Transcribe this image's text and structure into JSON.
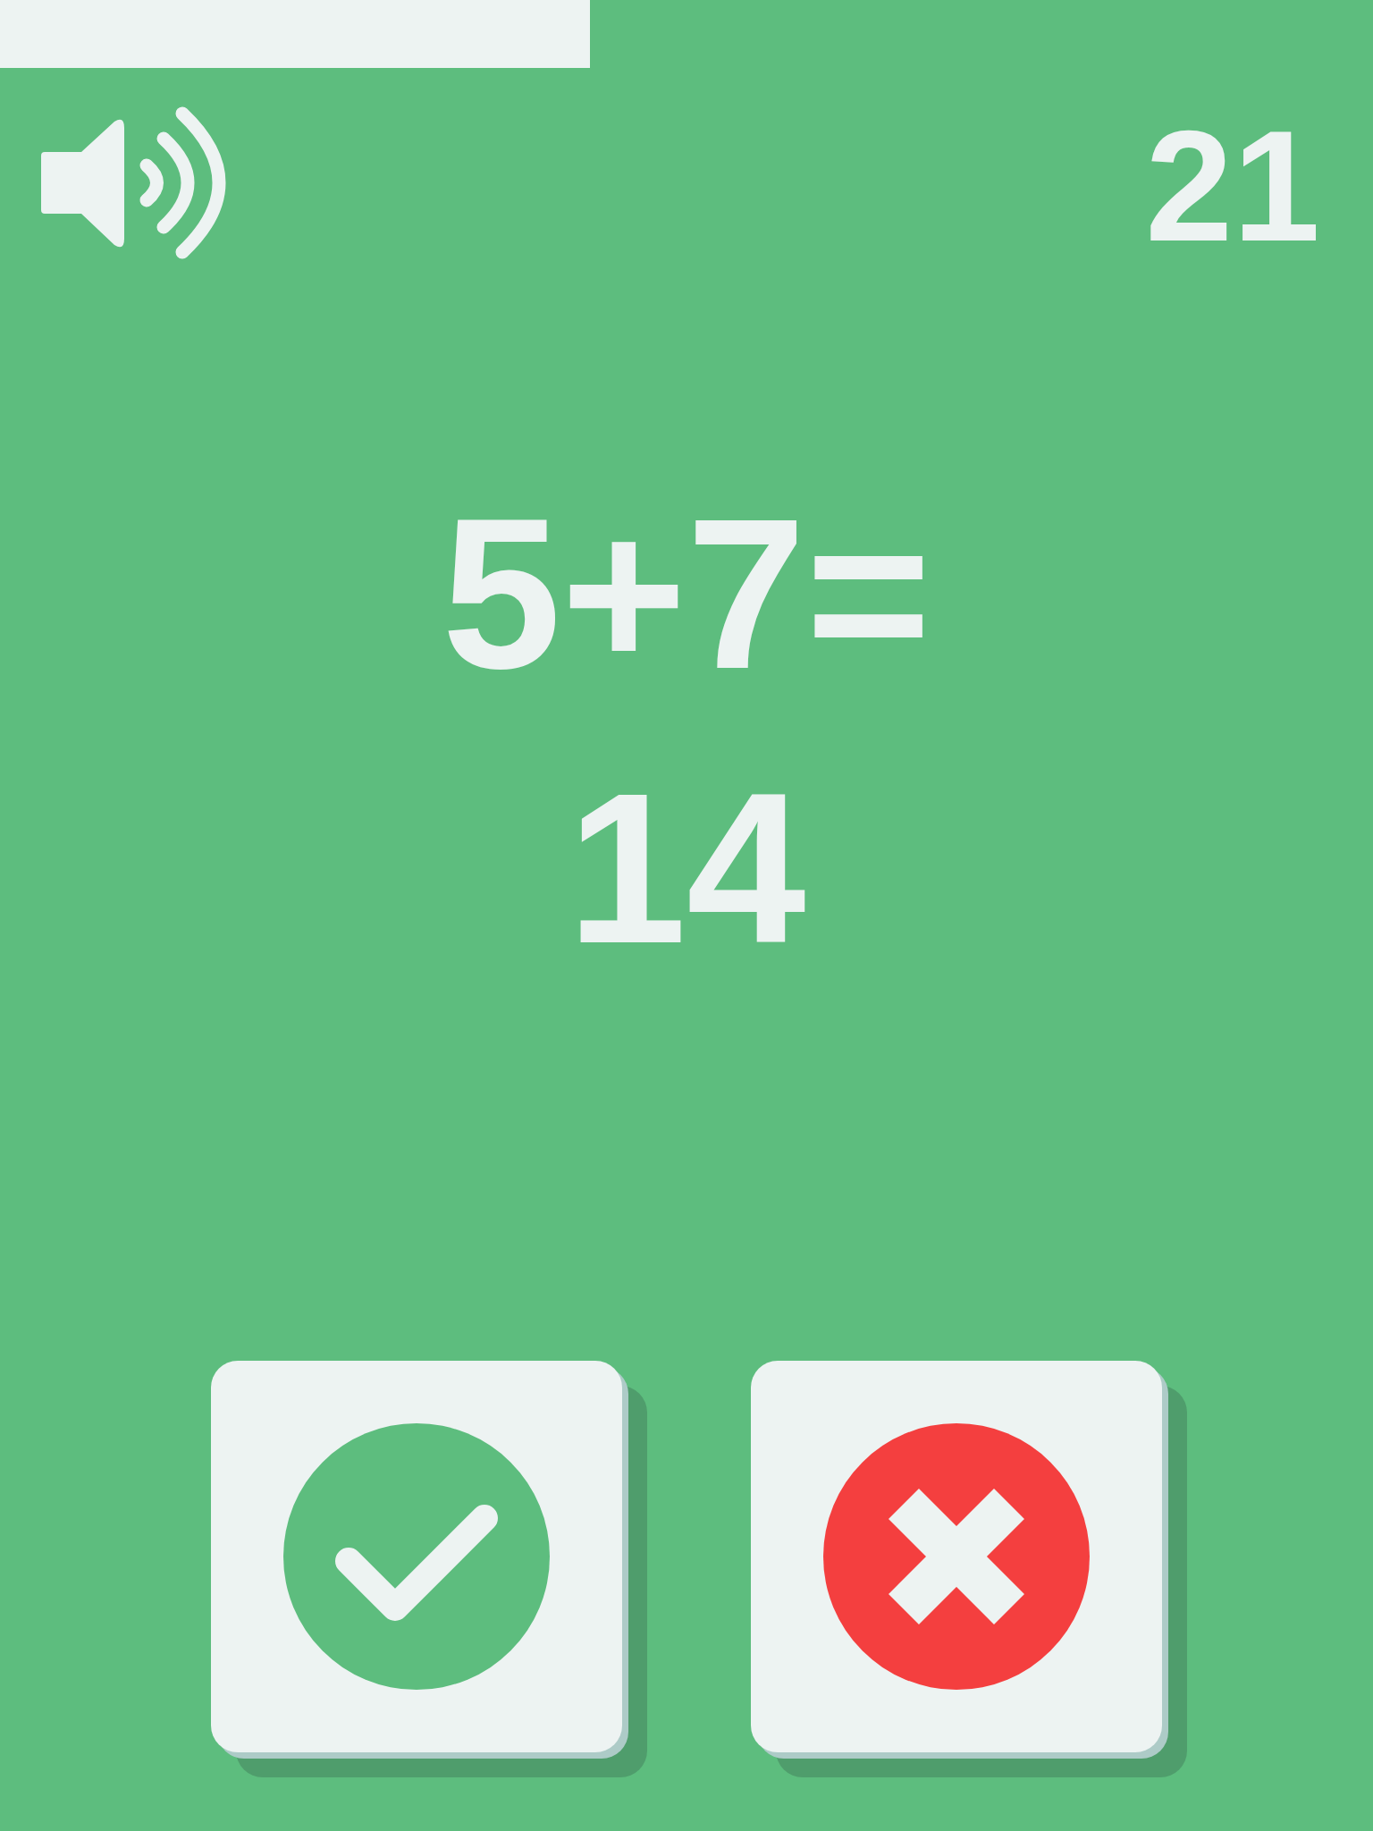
{
  "timer": {
    "level": 0.43
  },
  "sound": {
    "on": true
  },
  "score": "21",
  "question": {
    "equation": "5+7=",
    "answer": "14"
  },
  "buttons": [
    {
      "kind": "check"
    },
    {
      "kind": "cross"
    }
  ]
}
